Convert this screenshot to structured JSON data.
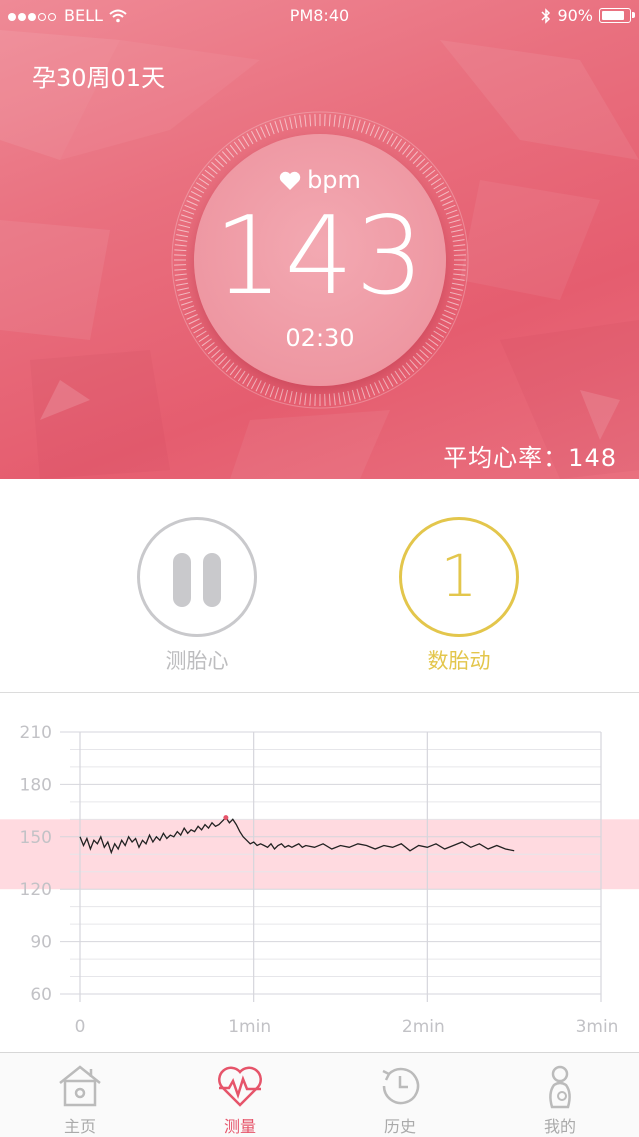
{
  "status_bar": {
    "carrier": "BELL",
    "time": "PM8:40",
    "battery": "90%",
    "battery_level": 0.9
  },
  "hero": {
    "pregnancy_week": "孕30周01天",
    "bpm_unit": "bpm",
    "current_bpm": "143",
    "timer": "02:30",
    "average_label": "平均心率：148"
  },
  "controls": {
    "fhr_label": "测胎心",
    "fm_count": "1",
    "fm_label": "数胎动"
  },
  "chart_data": {
    "type": "line",
    "y_ticks": [
      "210",
      "180",
      "150",
      "120",
      "90",
      "60"
    ],
    "x_ticks": [
      "0",
      "1min",
      "2min",
      "3min"
    ],
    "ylim": [
      60,
      210
    ],
    "xlim": [
      0,
      3
    ],
    "normal_band": [
      120,
      160
    ],
    "grid": true,
    "series": [
      {
        "x": [
          0,
          0.02,
          0.04,
          0.06,
          0.08,
          0.1,
          0.12,
          0.14,
          0.16,
          0.18,
          0.2,
          0.22,
          0.24,
          0.26,
          0.28,
          0.3,
          0.32,
          0.34,
          0.36,
          0.38,
          0.4,
          0.42,
          0.44,
          0.46,
          0.48,
          0.5,
          0.52,
          0.54,
          0.56,
          0.58,
          0.6,
          0.62,
          0.64,
          0.66,
          0.68,
          0.7,
          0.72,
          0.74,
          0.76,
          0.78,
          0.8,
          0.82,
          0.84,
          0.86,
          0.88,
          0.9,
          0.92,
          0.94,
          0.96,
          0.98,
          1.0,
          1.02,
          1.04,
          1.06,
          1.08,
          1.1,
          1.12,
          1.14,
          1.16,
          1.18,
          1.2,
          1.22,
          1.24,
          1.26,
          1.28,
          1.3,
          1.35,
          1.4,
          1.45,
          1.5,
          1.55,
          1.6,
          1.65,
          1.7,
          1.75,
          1.8,
          1.85,
          1.9,
          1.95,
          2.0,
          2.05,
          2.1,
          2.15,
          2.2,
          2.25,
          2.3,
          2.35,
          2.4,
          2.45,
          2.5
        ],
        "y": [
          150,
          145,
          149,
          143,
          148,
          146,
          150,
          144,
          147,
          141,
          146,
          143,
          148,
          145,
          150,
          147,
          149,
          144,
          148,
          146,
          151,
          147,
          150,
          148,
          152,
          149,
          151,
          150,
          153,
          151,
          155,
          152,
          154,
          153,
          156,
          154,
          157,
          155,
          158,
          156,
          157,
          159,
          161,
          158,
          160,
          157,
          153,
          150,
          148,
          146,
          147,
          145,
          146,
          145,
          144,
          146,
          143,
          145,
          146,
          144,
          145,
          144,
          145,
          146,
          144,
          145,
          144,
          146,
          143,
          145,
          144,
          146,
          145,
          143,
          145,
          144,
          146,
          142,
          145,
          144,
          146,
          143,
          145,
          147,
          144,
          146,
          143,
          145,
          143,
          142
        ]
      }
    ]
  },
  "tabs": [
    {
      "label": "主页",
      "icon": "home-icon",
      "active": false
    },
    {
      "label": "测量",
      "icon": "heart-pulse-icon",
      "active": true
    },
    {
      "label": "历史",
      "icon": "history-icon",
      "active": false
    },
    {
      "label": "我的",
      "icon": "profile-icon",
      "active": false
    }
  ],
  "colors": {
    "primary": "#e6546a",
    "accent_yellow": "#e3c64c",
    "band": "#ffd4da"
  }
}
